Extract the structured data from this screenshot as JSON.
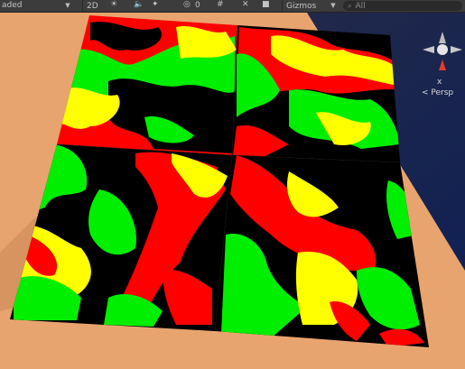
{
  "toolbar": {
    "shading_mode": "aded",
    "toggle_2d": "2D",
    "hidden_count": "0",
    "gizmos_label": "Gizmos",
    "search_placeholder": "All"
  },
  "scene_gizmo": {
    "x_axis_label": "x",
    "projection_label": "< Persp"
  },
  "colors": {
    "ground": "#e7a46e",
    "ground_shadow": "#c98654",
    "sky": "#20243a",
    "sky_edge": "#0e1f4f",
    "terrain_red": "#ff0000",
    "terrain_green": "#00ee00",
    "terrain_yellow": "#ffff00",
    "terrain_black": "#000000",
    "toolbar_bg": "#3c3c3c"
  },
  "scene": {
    "object": "noise-terrain-plane",
    "tile_grid": "2x2"
  }
}
